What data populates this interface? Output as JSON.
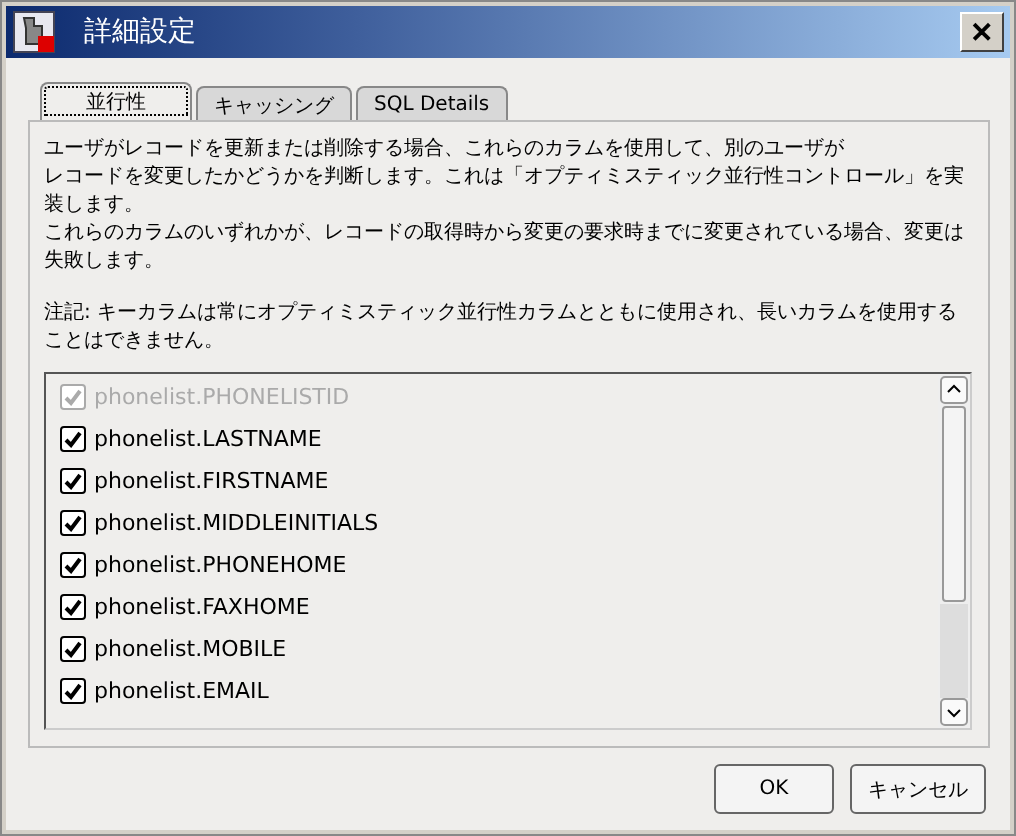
{
  "window": {
    "title": "詳細設定",
    "close": "✕"
  },
  "tabs": [
    {
      "label": "並行性",
      "selected": true
    },
    {
      "label": "キャッシング",
      "selected": false
    },
    {
      "label": "SQL Details",
      "selected": false
    }
  ],
  "description": [
    "ユーザがレコードを更新または削除する場合、これらのカラムを使用して、別のユーザが",
    "レコードを変更したかどうかを判断します。これは「オプティミスティック並行性コントロール」を実装します。",
    "これらのカラムのいずれかが、レコードの取得時から変更の要求時までに変更されている場合、変更は失敗します。"
  ],
  "note": "注記: キーカラムは常にオプティミスティック並行性カラムとともに使用され、長いカラムを使用することはできません。",
  "columns": [
    {
      "label": "phonelist.PHONELISTID",
      "checked": true,
      "disabled": true
    },
    {
      "label": "phonelist.LASTNAME",
      "checked": true,
      "disabled": false
    },
    {
      "label": "phonelist.FIRSTNAME",
      "checked": true,
      "disabled": false
    },
    {
      "label": "phonelist.MIDDLEINITIALS",
      "checked": true,
      "disabled": false
    },
    {
      "label": "phonelist.PHONEHOME",
      "checked": true,
      "disabled": false
    },
    {
      "label": "phonelist.FAXHOME",
      "checked": true,
      "disabled": false
    },
    {
      "label": "phonelist.MOBILE",
      "checked": true,
      "disabled": false
    },
    {
      "label": "phonelist.EMAIL",
      "checked": true,
      "disabled": false
    }
  ],
  "buttons": [
    "OK",
    "キャンセル"
  ]
}
